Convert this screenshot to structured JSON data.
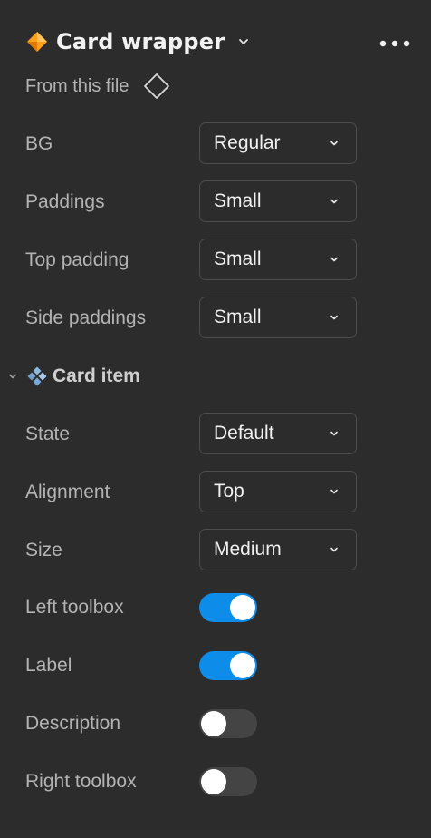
{
  "header": {
    "icon": "component-instance-icon",
    "icon_color": "#ff9f1c",
    "title": "Card wrapper",
    "more_icon": "more-horizontal-icon"
  },
  "source": {
    "label": "From this file",
    "icon": "component-diamond-icon"
  },
  "properties": [
    {
      "label": "BG",
      "value": "Regular"
    },
    {
      "label": "Paddings",
      "value": "Small"
    },
    {
      "label": "Top padding",
      "value": "Small"
    },
    {
      "label": "Side paddings",
      "value": "Small"
    }
  ],
  "nested_section": {
    "title": "Card item",
    "icon": "component-main-icon",
    "icon_color": "#8fb8e0",
    "expanded": true,
    "properties": [
      {
        "label": "State",
        "value": "Default"
      },
      {
        "label": "Alignment",
        "value": "Top"
      },
      {
        "label": "Size",
        "value": "Medium"
      }
    ],
    "toggles": [
      {
        "label": "Left toolbox",
        "on": true
      },
      {
        "label": "Label",
        "on": true
      },
      {
        "label": "Description",
        "on": false
      },
      {
        "label": "Right toolbox",
        "on": false
      }
    ]
  },
  "colors": {
    "background": "#2c2c2c",
    "toggle_on": "#0d8ce9",
    "toggle_off": "#444444",
    "border": "#4d4d4d"
  }
}
